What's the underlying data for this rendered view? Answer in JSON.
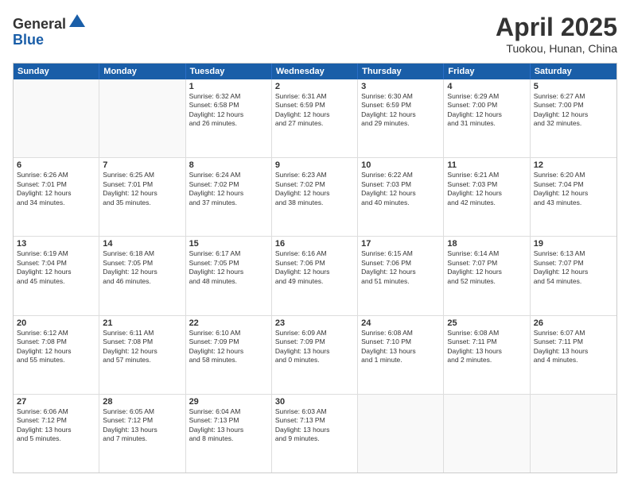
{
  "header": {
    "logo_general": "General",
    "logo_blue": "Blue",
    "title": "April 2025",
    "location": "Tuokou, Hunan, China"
  },
  "days": [
    "Sunday",
    "Monday",
    "Tuesday",
    "Wednesday",
    "Thursday",
    "Friday",
    "Saturday"
  ],
  "weeks": [
    [
      {
        "date": "",
        "info": ""
      },
      {
        "date": "",
        "info": ""
      },
      {
        "date": "1",
        "info": "Sunrise: 6:32 AM\nSunset: 6:58 PM\nDaylight: 12 hours\nand 26 minutes."
      },
      {
        "date": "2",
        "info": "Sunrise: 6:31 AM\nSunset: 6:59 PM\nDaylight: 12 hours\nand 27 minutes."
      },
      {
        "date": "3",
        "info": "Sunrise: 6:30 AM\nSunset: 6:59 PM\nDaylight: 12 hours\nand 29 minutes."
      },
      {
        "date": "4",
        "info": "Sunrise: 6:29 AM\nSunset: 7:00 PM\nDaylight: 12 hours\nand 31 minutes."
      },
      {
        "date": "5",
        "info": "Sunrise: 6:27 AM\nSunset: 7:00 PM\nDaylight: 12 hours\nand 32 minutes."
      }
    ],
    [
      {
        "date": "6",
        "info": "Sunrise: 6:26 AM\nSunset: 7:01 PM\nDaylight: 12 hours\nand 34 minutes."
      },
      {
        "date": "7",
        "info": "Sunrise: 6:25 AM\nSunset: 7:01 PM\nDaylight: 12 hours\nand 35 minutes."
      },
      {
        "date": "8",
        "info": "Sunrise: 6:24 AM\nSunset: 7:02 PM\nDaylight: 12 hours\nand 37 minutes."
      },
      {
        "date": "9",
        "info": "Sunrise: 6:23 AM\nSunset: 7:02 PM\nDaylight: 12 hours\nand 38 minutes."
      },
      {
        "date": "10",
        "info": "Sunrise: 6:22 AM\nSunset: 7:03 PM\nDaylight: 12 hours\nand 40 minutes."
      },
      {
        "date": "11",
        "info": "Sunrise: 6:21 AM\nSunset: 7:03 PM\nDaylight: 12 hours\nand 42 minutes."
      },
      {
        "date": "12",
        "info": "Sunrise: 6:20 AM\nSunset: 7:04 PM\nDaylight: 12 hours\nand 43 minutes."
      }
    ],
    [
      {
        "date": "13",
        "info": "Sunrise: 6:19 AM\nSunset: 7:04 PM\nDaylight: 12 hours\nand 45 minutes."
      },
      {
        "date": "14",
        "info": "Sunrise: 6:18 AM\nSunset: 7:05 PM\nDaylight: 12 hours\nand 46 minutes."
      },
      {
        "date": "15",
        "info": "Sunrise: 6:17 AM\nSunset: 7:05 PM\nDaylight: 12 hours\nand 48 minutes."
      },
      {
        "date": "16",
        "info": "Sunrise: 6:16 AM\nSunset: 7:06 PM\nDaylight: 12 hours\nand 49 minutes."
      },
      {
        "date": "17",
        "info": "Sunrise: 6:15 AM\nSunset: 7:06 PM\nDaylight: 12 hours\nand 51 minutes."
      },
      {
        "date": "18",
        "info": "Sunrise: 6:14 AM\nSunset: 7:07 PM\nDaylight: 12 hours\nand 52 minutes."
      },
      {
        "date": "19",
        "info": "Sunrise: 6:13 AM\nSunset: 7:07 PM\nDaylight: 12 hours\nand 54 minutes."
      }
    ],
    [
      {
        "date": "20",
        "info": "Sunrise: 6:12 AM\nSunset: 7:08 PM\nDaylight: 12 hours\nand 55 minutes."
      },
      {
        "date": "21",
        "info": "Sunrise: 6:11 AM\nSunset: 7:08 PM\nDaylight: 12 hours\nand 57 minutes."
      },
      {
        "date": "22",
        "info": "Sunrise: 6:10 AM\nSunset: 7:09 PM\nDaylight: 12 hours\nand 58 minutes."
      },
      {
        "date": "23",
        "info": "Sunrise: 6:09 AM\nSunset: 7:09 PM\nDaylight: 13 hours\nand 0 minutes."
      },
      {
        "date": "24",
        "info": "Sunrise: 6:08 AM\nSunset: 7:10 PM\nDaylight: 13 hours\nand 1 minute."
      },
      {
        "date": "25",
        "info": "Sunrise: 6:08 AM\nSunset: 7:11 PM\nDaylight: 13 hours\nand 2 minutes."
      },
      {
        "date": "26",
        "info": "Sunrise: 6:07 AM\nSunset: 7:11 PM\nDaylight: 13 hours\nand 4 minutes."
      }
    ],
    [
      {
        "date": "27",
        "info": "Sunrise: 6:06 AM\nSunset: 7:12 PM\nDaylight: 13 hours\nand 5 minutes."
      },
      {
        "date": "28",
        "info": "Sunrise: 6:05 AM\nSunset: 7:12 PM\nDaylight: 13 hours\nand 7 minutes."
      },
      {
        "date": "29",
        "info": "Sunrise: 6:04 AM\nSunset: 7:13 PM\nDaylight: 13 hours\nand 8 minutes."
      },
      {
        "date": "30",
        "info": "Sunrise: 6:03 AM\nSunset: 7:13 PM\nDaylight: 13 hours\nand 9 minutes."
      },
      {
        "date": "",
        "info": ""
      },
      {
        "date": "",
        "info": ""
      },
      {
        "date": "",
        "info": ""
      }
    ]
  ]
}
